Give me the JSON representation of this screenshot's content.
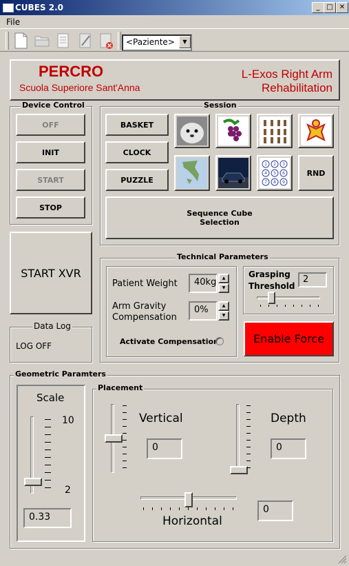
{
  "window": {
    "title": "CUBES 2.0",
    "minimize": "_",
    "maximize": "□",
    "close": "✕"
  },
  "menu": {
    "file": "File"
  },
  "toolbar": {
    "patient_combo": "<Paziente>"
  },
  "header": {
    "org_title": "PERCRO",
    "org_subtitle": "Scuola Superiore Sant'Anna",
    "app_line1": "L-Exos Right Arm",
    "app_line2": "Rehabilitation"
  },
  "device_control": {
    "legend": "Device Control",
    "off": "OFF",
    "init": "INIT",
    "start": "START",
    "stop": "STOP"
  },
  "session": {
    "legend": "Session",
    "basket": "BASKET",
    "clock": "CLOCK",
    "puzzle": "PUZZLE",
    "rnd": "RND",
    "sequence_line1": "Sequence Cube",
    "sequence_line2": "Selection"
  },
  "start_xvr": "START XVR",
  "data_log": {
    "legend": "Data Log",
    "status": "LOG OFF"
  },
  "technical": {
    "legend": "Technical Parameters",
    "patient_weight_label": "Patient Weight",
    "patient_weight_value": "40kg",
    "arm_gravity_line1": "Arm Gravity",
    "arm_gravity_line2": "Compensation",
    "arm_gravity_value": "0%",
    "activate_compensation": "Activate Compensation",
    "grasping_line1": "Grasping",
    "grasping_line2": "Threshold",
    "grasping_value": "2",
    "enable_force": "Enable Force",
    "enable_force_color": "#ff0000"
  },
  "geometric": {
    "legend": "Geometric Paramters",
    "scale_label": "Scale",
    "scale_max": "10",
    "scale_min": "2",
    "scale_value": "0.33",
    "placement_legend": "Placement",
    "vertical_label": "Vertical",
    "vertical_value": "0",
    "depth_label": "Depth",
    "depth_value": "0",
    "horizontal_label": "Horizontal",
    "horizontal_value": "0"
  }
}
